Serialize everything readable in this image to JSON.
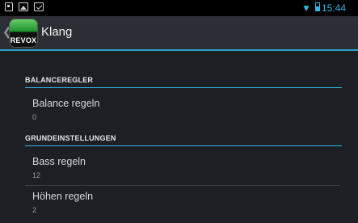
{
  "status_bar": {
    "time": "15:44",
    "icons": [
      "sim-notification-icon",
      "image-notification-icon",
      "download-notification-icon",
      "wifi-icon",
      "battery-icon"
    ]
  },
  "action_bar": {
    "logo_text": "REVOX",
    "title": "Klang"
  },
  "sections": [
    {
      "header": "BALANCEREGLER",
      "items": [
        {
          "title": "Balance regeln",
          "summary": "0"
        }
      ]
    },
    {
      "header": "GRUNDEINSTELLUNGEN",
      "items": [
        {
          "title": "Bass regeln",
          "summary": "12"
        },
        {
          "title": "Höhen regeln",
          "summary": "2"
        }
      ]
    }
  ],
  "colors": {
    "accent": "#33b5e5",
    "background": "#1c1f24",
    "action_bar": "#2b2f35"
  }
}
